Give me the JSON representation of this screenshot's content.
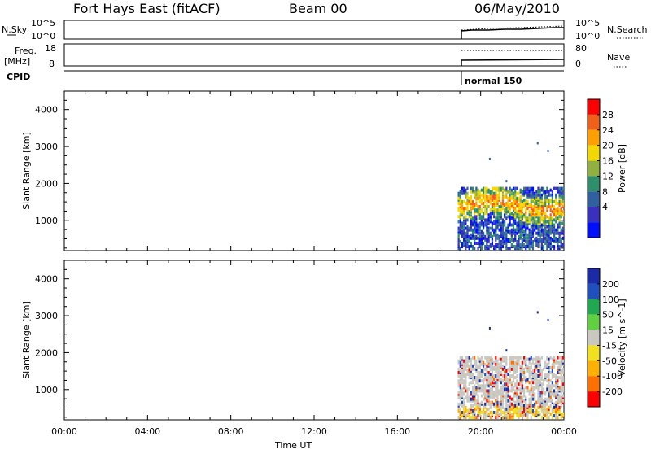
{
  "header": {
    "title": "Fort Hays East (fitACF)",
    "beam": "Beam 00",
    "date": "06/May/2010"
  },
  "top_panels": {
    "nsky_label": "N.Sky",
    "nsearch_label": "N.Search",
    "log_top": "10^5",
    "log_bottom": "10^0",
    "freq_label": "Freq.",
    "freq_unit": "[MHz]",
    "freq_ticks": [
      "18",
      "8"
    ],
    "nave_label": "Nave",
    "nave_ticks": [
      "80",
      "0"
    ],
    "cpid_label": "CPID",
    "cpid_value": "normal 150"
  },
  "chart_data": [
    {
      "type": "heatmap",
      "name": "power",
      "ylabel": "Slant Range [km]",
      "xlabel": "",
      "ylim": [
        180,
        4500
      ],
      "xlim": [
        0,
        24
      ],
      "yticks": [
        1000,
        2000,
        3000,
        4000
      ],
      "colorbar": {
        "label": "Power [dB]",
        "ticks": [
          "28",
          "24",
          "20",
          "16",
          "12",
          "8",
          "4"
        ],
        "colors": [
          "#ff0000",
          "#f06018",
          "#ffa000",
          "#f2d800",
          "#90b040",
          "#2f8f6a",
          "#3060a0",
          "#3a30c0",
          "#0010ff"
        ]
      },
      "data_region": {
        "t_start": 18.9,
        "t_end": 24.0,
        "range_min": 200,
        "range_max": 1850
      }
    },
    {
      "type": "heatmap",
      "name": "velocity",
      "ylabel": "Slant Range [km]",
      "xlabel": "Time UT",
      "ylim": [
        180,
        4500
      ],
      "xlim": [
        0,
        24
      ],
      "yticks": [
        1000,
        2000,
        3000,
        4000
      ],
      "xticks": [
        "00:00",
        "04:00",
        "08:00",
        "12:00",
        "16:00",
        "20:00",
        "00:00"
      ],
      "colorbar": {
        "label": "Velocity [m s^-1]",
        "ticks": [
          "200",
          "100",
          "50",
          "15",
          "-15",
          "-50",
          "-100",
          "-200"
        ],
        "colors": [
          "#1a2aa8",
          "#2050c0",
          "#20a850",
          "#60d040",
          "#c8c8c0",
          "#f0e020",
          "#ffb000",
          "#ff7000",
          "#ff0000"
        ]
      },
      "data_region": {
        "t_start": 18.9,
        "t_end": 24.0,
        "range_min": 200,
        "range_max": 1850
      }
    }
  ]
}
